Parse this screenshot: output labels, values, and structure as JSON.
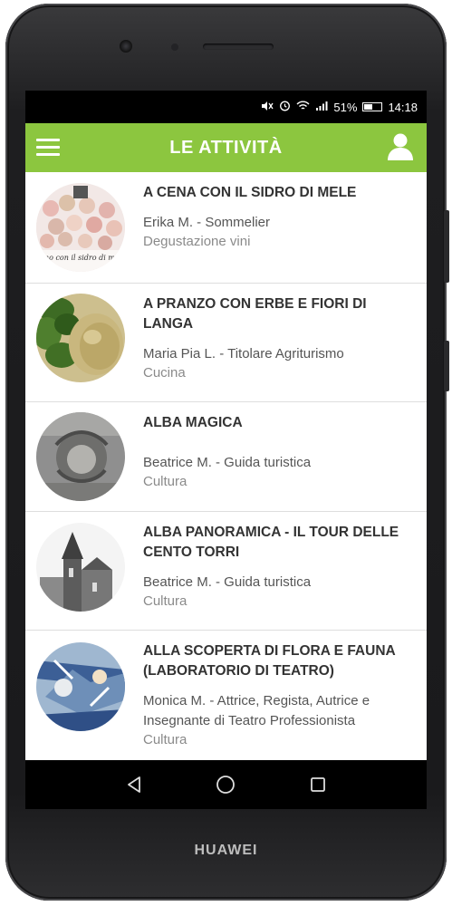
{
  "device": {
    "brand": "HUAWEI"
  },
  "status_bar": {
    "battery": "51%",
    "time": "14:18"
  },
  "app_bar": {
    "title": "LE ATTIVITÀ"
  },
  "activities": [
    {
      "title": "A CENA CON IL SIDRO DI MELE",
      "author": "Erika M. - Sommelier",
      "category": "Degustazione vini",
      "thumb_text": "ino con il sidro di me"
    },
    {
      "title": "A PRANZO CON ERBE E FIORI DI LANGA",
      "author": "Maria Pia L. - Titolare Agriturismo",
      "category": "Cucina"
    },
    {
      "title": "ALBA MAGICA",
      "author": "Beatrice M. - Guida turistica",
      "category": "Cultura"
    },
    {
      "title": "ALBA PANORAMICA - IL TOUR DELLE CENTO TORRI",
      "author": "Beatrice M. - Guida turistica",
      "category": "Cultura"
    },
    {
      "title": "ALLA SCOPERTA DI FLORA E FAUNA (LABORATORIO DI TEATRO)",
      "author": "Monica M. - Attrice, Regista, Autrice e Insegnante di Teatro Professionista",
      "category": "Cultura"
    }
  ],
  "colors": {
    "accent": "#8cc63f",
    "status_bar": "#000000",
    "title_text": "#333333",
    "category_text": "#8a8a8a"
  }
}
